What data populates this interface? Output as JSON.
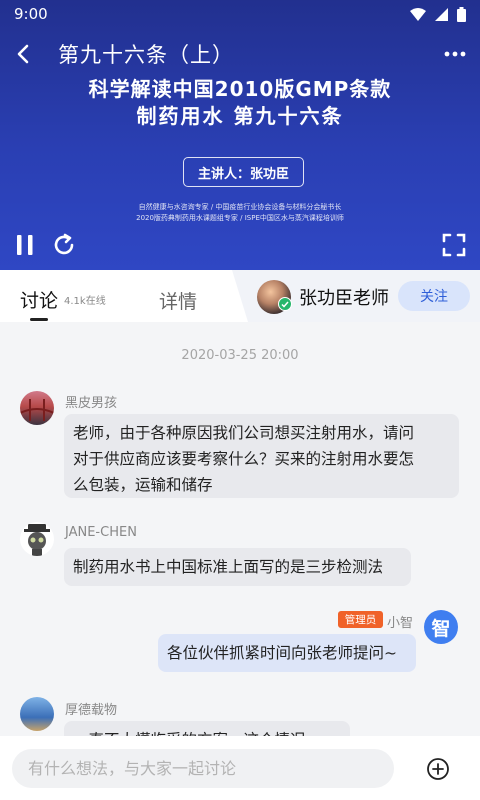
{
  "status_bar": {
    "time": "9:00"
  },
  "video": {
    "title": "第九十六条（上）",
    "slide_title_line1": "科学解读中国2010版GMP条款",
    "slide_title_line2": "制药用水 第九十六条",
    "speaker": "主讲人：张功臣",
    "subtitle_line1": "自然健康与水咨询专家 / 中国疫苗行业协会设备与材料分会秘书长",
    "subtitle_line2": "2020版药典制药用水课题组专家 / ISPE中国区水与蒸汽课程培训师",
    "colors": {
      "background": "#2a3fb3"
    }
  },
  "tabs": {
    "discuss_label": "讨论",
    "online_count": "4.1k在线",
    "detail_label": "详情"
  },
  "teacher": {
    "name": "张功臣老师",
    "follow_label": "关注"
  },
  "chat": {
    "timestamp": "2020-03-25 20:00",
    "messages": [
      {
        "user": "黑皮男孩",
        "lines": [
          "老师，由于各种原因我们公司想买注射用水，请问",
          "对于供应商应该要考察什么？买来的注射用水要怎",
          "么包装，运输和储存"
        ]
      },
      {
        "user": "JANE-CHEN",
        "lines": [
          "制药用水书上中国标准上面写的是三步检测法"
        ]
      },
      {
        "user": "小智",
        "badge": "管理员",
        "avatar_char": "智",
        "lines": [
          "各位伙伴抓紧时间向张老师提问~"
        ]
      },
      {
        "user": "厚德载物",
        "lines": [
          "一直不太懂临采的方案，这个情况..."
        ]
      }
    ]
  },
  "input": {
    "placeholder": "有什么想法，与大家一起讨论"
  },
  "colors": {
    "accent": "#2f5fd8",
    "admin_badge": "#f06229",
    "verified": "#27b66b"
  }
}
